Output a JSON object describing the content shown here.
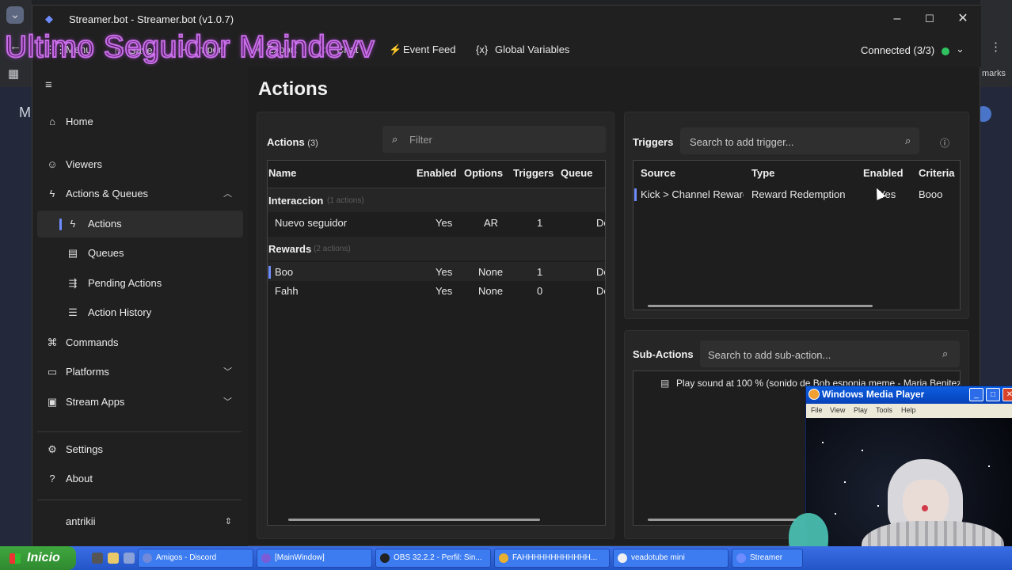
{
  "overlay_banner": "Ultimo Seguidor Maindevv",
  "window": {
    "title": "Streamer.bot - Streamer.bot (v1.0.7)"
  },
  "toolbar": {
    "menu": "Menu",
    "save": "Save",
    "import": "Import",
    "export": "Export",
    "chat": "Chat",
    "event_feed": "Event Feed",
    "global_variables": "Global Variables",
    "connection_status": "Connected (3/3)"
  },
  "sidebar": {
    "home": "Home",
    "viewers": "Viewers",
    "actions_queues": "Actions & Queues",
    "actions": "Actions",
    "queues": "Queues",
    "pending_actions": "Pending Actions",
    "action_history": "Action History",
    "commands": "Commands",
    "platforms": "Platforms",
    "stream_apps": "Stream Apps",
    "settings": "Settings",
    "about": "About",
    "user": "antrikii"
  },
  "main": {
    "title": "Actions"
  },
  "actions_panel": {
    "label": "Actions",
    "count": "(3)",
    "filter_placeholder": "Filter",
    "columns": [
      "Name",
      "Enabled",
      "Options",
      "Triggers",
      "Queue"
    ],
    "groups": [
      {
        "name": "Interaccion",
        "count": "(1 actions)",
        "rows": [
          {
            "name": "Nuevo seguidor",
            "enabled": "Yes",
            "options": "AR",
            "triggers": "1",
            "queue": "De"
          }
        ]
      },
      {
        "name": "Rewards",
        "count": "(2 actions)",
        "rows": [
          {
            "name": "Boo",
            "enabled": "Yes",
            "options": "None",
            "triggers": "1",
            "queue": "De"
          },
          {
            "name": "Fahh",
            "enabled": "Yes",
            "options": "None",
            "triggers": "0",
            "queue": "De"
          }
        ]
      }
    ]
  },
  "triggers_panel": {
    "label": "Triggers",
    "search_placeholder": "Search to add trigger...",
    "columns": [
      "Source",
      "Type",
      "Enabled",
      "Criteria"
    ],
    "rows": [
      {
        "source": "Kick > Channel Reward",
        "type": "Reward Redemption",
        "enabled": "Yes",
        "criteria": "Booo"
      }
    ]
  },
  "subactions_panel": {
    "label": "Sub-Actions",
    "search_placeholder": "Search to add sub-action...",
    "items": [
      "Play sound at 100 % (sonido de Bob esponja meme - Maria Benitez"
    ]
  },
  "media_player": {
    "title": "Windows Media Player",
    "menu": [
      "File",
      "View",
      "Play",
      "Tools",
      "Help"
    ]
  },
  "taskbar": {
    "start": "Inicio",
    "tasks": [
      "Amigos - Discord",
      "[MainWindow]",
      "OBS 32.2.2 - Perfil: Sin...",
      "FAHHHHHHHHHHHH...",
      "veadotube mini",
      "Streamer"
    ]
  },
  "browser": {
    "bookmarks_fragment": "marks",
    "side_letter": "M"
  }
}
